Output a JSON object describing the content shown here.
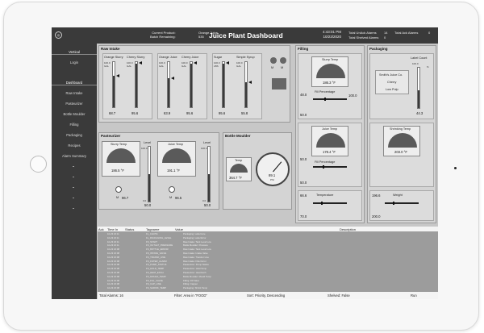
{
  "header": {
    "current_product_label": "Current Product:",
    "batch_remaining_label": "Batch Remaining:",
    "current_product": "Orange Juice",
    "batch_remaining": "535",
    "title": "Juice Plant Dashboard",
    "time": "4:43:01 PM",
    "date": "10/23/2020",
    "total_unack_label": "Total UnAck Alarms",
    "total_unack": "14",
    "total_shelved_label": "Total Shelved Alarms",
    "total_shelved": "0",
    "total_ack_label": "Total Ack Alarms",
    "total_ack": "0"
  },
  "sidebar": {
    "items": [
      "Vertical",
      "Login",
      "Dashboard",
      "Raw Intake",
      "Pasteurizer",
      "Bottle Moulder",
      "Filling",
      "Packaging",
      "Recipes",
      "Alarm Summary"
    ]
  },
  "raw_intake": {
    "title": "Raw Intake",
    "tanks": [
      {
        "label": "Orange Slurry",
        "max": "100.0",
        "unit": "GAL",
        "value": "68.7",
        "level": 0.69
      },
      {
        "label": "Cherry Slurry",
        "max": "100.0",
        "unit": "GAL",
        "value": "95.6",
        "level": 0.96
      },
      {
        "label": "Orange Juice",
        "max": "100.0",
        "unit": "GAL",
        "value": "63.9",
        "level": 0.64
      },
      {
        "label": "Cherry Juice",
        "max": "100.0",
        "unit": "GAL",
        "value": "95.6",
        "level": 0.96
      },
      {
        "label": "Sugar",
        "max": "100.0",
        "unit": "LBS",
        "value": "95.6",
        "level": 0.96
      },
      {
        "label": "Simple Syrup",
        "max": "100.0",
        "unit": "GAL",
        "value": "55.8",
        "level": 0.56
      }
    ],
    "motor_label": "M"
  },
  "pasteurizer": {
    "title": "Pasteurizer",
    "slurry_temp_label": "Slurry Temp",
    "slurry_temp": "186.5 °F",
    "juice_temp_label": "Juice Temp",
    "juice_temp": "191.1 °F",
    "level_label": "Level",
    "level_min": "0.0",
    "level_max": "100.0",
    "level1": "50.0",
    "level2": "50.0",
    "motor1": "96.7",
    "motor2": "96.5",
    "motor_label": "M"
  },
  "bottle_moulder": {
    "title": "Bottle Moulder",
    "temp_label": "Temp",
    "temp": "364.7 °F",
    "pressure": "89.1",
    "pressure_unit": "PSI"
  },
  "filling": {
    "title": "Filling",
    "slurry_temp_label": "Slurry Temp",
    "slurry_temp": "186.3 °F",
    "fill_pct_label": "Fill Percentage",
    "fill1_min": "48.0",
    "fill1_max": "100.0",
    "fill1_val": "50.0",
    "juice_temp_label": "Juice Temp",
    "juice_temp": "178.4 °F",
    "fill2_min": "50.0",
    "fill2_val": "50.0",
    "temperature_label": "Temperature",
    "temperature_min": "66.6",
    "temperature_val": "70.0"
  },
  "packaging": {
    "title": "Packaging",
    "label_count_label": "Label Count",
    "label_count_max": "100.0",
    "label_count_val": "44.3",
    "label_unit": "%",
    "recipe_lines": [
      "Smith's Juice Co.",
      "Cherry",
      "Low Pulp"
    ],
    "shrinking_temp_label": "Shrinking Temp",
    "shrinking_temp": "203.0 °F",
    "weight_label": "Weight",
    "weight_min": "196.6",
    "weight_val": "200.0"
  },
  "alarm_table": {
    "headers": [
      "Ack",
      "Time In",
      "Status",
      "Tagname",
      "Value",
      "Description"
    ],
    "rows": [
      [
        "10-23 16:11",
        "FL_CHUTE",
        "Packaging: Label Line"
      ],
      [
        "10-23 16:11",
        "FL_PACKAGING_LEVEL",
        "Packaging: Label Error"
      ],
      [
        "10-23 16:11",
        "FS_START",
        "Raw Intake: Tank Level Low"
      ],
      [
        "10-23 16:11",
        "FS_OUTLET_PRESSURE",
        "Bottle Moulder: Pressure"
      ],
      [
        "10-23 16:08",
        "FS_BOTTLE_ERROR",
        "Raw Intake: Tank Level Low"
      ],
      [
        "10-23 16:08",
        "FS_INTAKE_VALVE",
        "Raw Intake: Intake Valve"
      ],
      [
        "10-23 16:08",
        "FS_TRANSF_LINE",
        "Raw Intake: Transfer Line"
      ],
      [
        "10-23 16:08",
        "FS_FILTER_ALARM",
        "Raw Intake: Filter Error"
      ],
      [
        "10-23 16:08",
        "FS_PUMP_STATUS",
        "Pasteurizer: Pump Status"
      ],
      [
        "10-23 16:08",
        "FS_HOLD_TEMP",
        "Pasteurizer: Hold Temp"
      ],
      [
        "10-23 16:08",
        "FS_HEAT_EXCH",
        "Pasteurizer: Heat Exch"
      ],
      [
        "10-23 16:08",
        "FS_MOULD_TEMP",
        "Bottle Moulder: Mould Temp"
      ],
      [
        "10-23 16:08",
        "FS_FILL_VALVE",
        "Filling: Fill Valve"
      ],
      [
        "10-23 16:08",
        "FS_CAP_LINE",
        "Filling: Capper"
      ],
      [
        "10-23 16:08",
        "FS_SHRINK_TEMP",
        "Packaging: Shrink Temp"
      ]
    ],
    "total_label": "Total Alarms: 16",
    "filter_label": "Filter: Area in \"FOOD\"",
    "sort_label": "Sort: Priority, Descending",
    "shelved_label": "Shelved: False",
    "run_label": "Run"
  }
}
